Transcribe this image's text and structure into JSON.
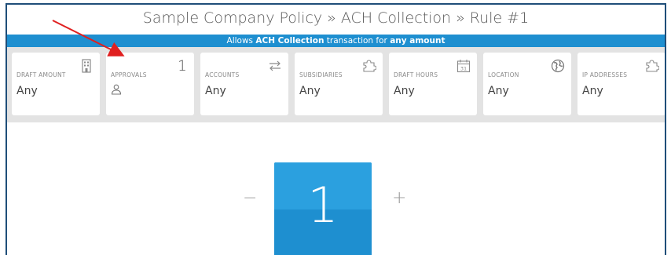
{
  "title": "Sample Company Policy » ACH Collection » Rule #1",
  "banner": {
    "prefix": "Allows ",
    "transaction": "ACH Collection",
    "middle": " transaction for ",
    "amount": "any amount"
  },
  "cards": [
    {
      "label": "DRAFT AMOUNT",
      "value": "Any",
      "icon": "building-icon"
    },
    {
      "label": "APPROVALS",
      "count": "1",
      "icon": "person-icon"
    },
    {
      "label": "ACCOUNTS",
      "value": "Any",
      "icon": "transfer-arrows-icon"
    },
    {
      "label": "SUBSIDIARIES",
      "value": "Any",
      "icon": "puzzle-icon"
    },
    {
      "label": "DRAFT HOURS",
      "value": "Any",
      "icon": "calendar-icon",
      "calendar_day": "31"
    },
    {
      "label": "LOCATION",
      "value": "Any",
      "icon": "globe-icon"
    },
    {
      "label": "IP ADDRESSES",
      "value": "Any",
      "icon": "puzzle-icon"
    }
  ],
  "stepper": {
    "minus": "−",
    "value": "1",
    "plus": "+"
  },
  "colors": {
    "accent": "#1e8fd0",
    "frame_border": "#1f4e79",
    "annotation_arrow": "#e02020"
  }
}
